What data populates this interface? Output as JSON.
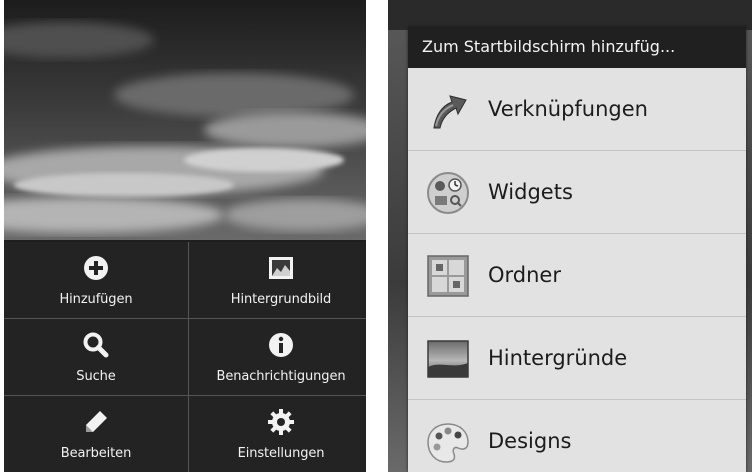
{
  "left_screen": {
    "menu_items": [
      {
        "label": "Hinzufügen",
        "icon": "add-icon"
      },
      {
        "label": "Hintergrundbild",
        "icon": "wallpaper-icon"
      },
      {
        "label": "Suche",
        "icon": "search-icon"
      },
      {
        "label": "Benachrichtigungen",
        "icon": "info-icon"
      },
      {
        "label": "Bearbeiten",
        "icon": "pencil-icon"
      },
      {
        "label": "Einstellungen",
        "icon": "gear-icon"
      }
    ]
  },
  "right_screen": {
    "dialog_title": "Zum Startbildschirm hinzufüg...",
    "items": [
      {
        "label": "Verknüpfungen",
        "icon": "shortcut-arrow-icon"
      },
      {
        "label": "Widgets",
        "icon": "widgets-icon"
      },
      {
        "label": "Ordner",
        "icon": "folder-icon"
      },
      {
        "label": "Hintergründe",
        "icon": "wallpapers-icon"
      },
      {
        "label": "Designs",
        "icon": "palette-icon"
      }
    ]
  },
  "colors": {
    "menu_bg": "#232323",
    "dialog_bg": "#e2e2e2",
    "title_bg": "#202020"
  }
}
